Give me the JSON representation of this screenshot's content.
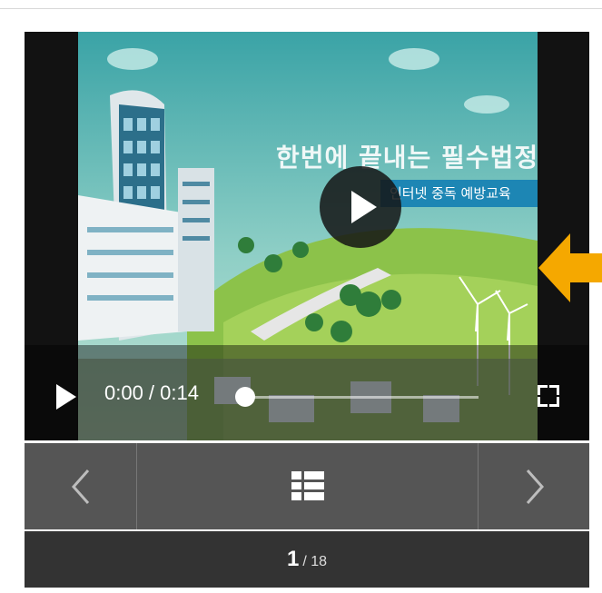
{
  "video": {
    "overlay_title": "한번에 끝내는 필수법정교육",
    "overlay_subtitle": "인터넷 중독 예방교육",
    "current_time": "0:00",
    "duration": "0:14",
    "time_display": "0:00 / 0:14",
    "progress_fraction": 0.0
  },
  "icons": {
    "big_play": "play-icon",
    "control_play": "play-icon",
    "fullscreen": "fullscreen-icon",
    "pointer": "arrow-left-icon",
    "prev": "chevron-left-icon",
    "menu": "list-menu-icon",
    "next": "chevron-right-icon"
  },
  "pager": {
    "current": "1",
    "separator": "/",
    "total": "18"
  },
  "colors": {
    "pointer_arrow": "#f5a800",
    "nav_bar": "#555555",
    "pager_bar": "#333333"
  }
}
